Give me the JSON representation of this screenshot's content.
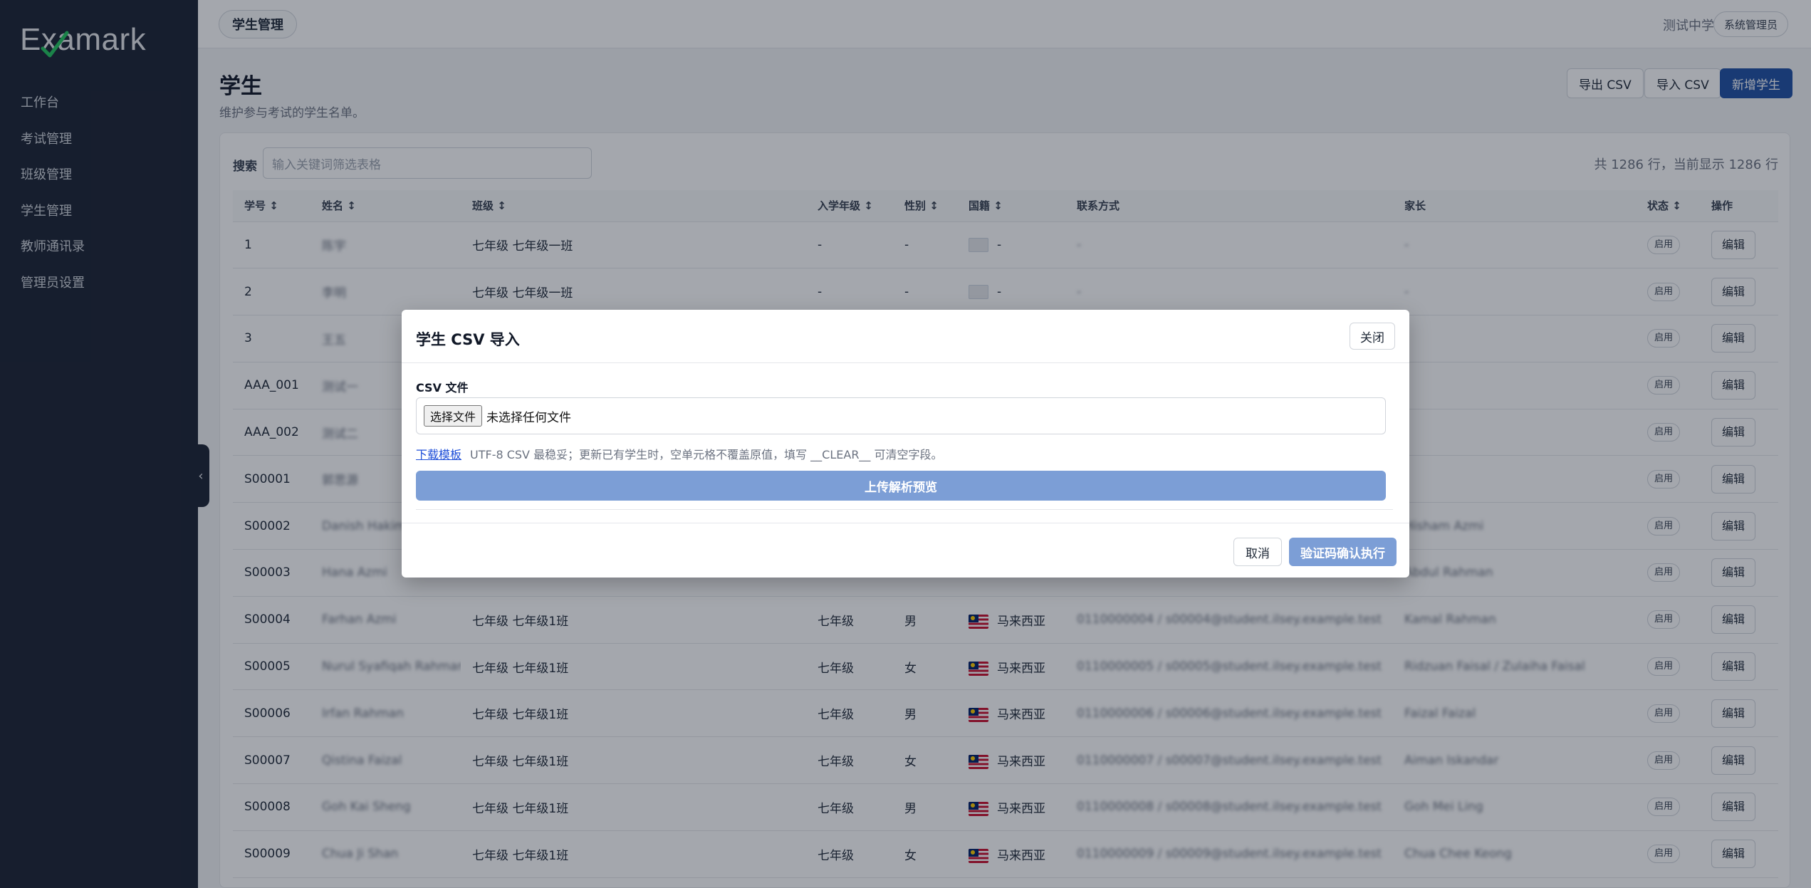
{
  "brand": {
    "logo_text": "Examark"
  },
  "sidebar": {
    "items": [
      {
        "label": "工作台"
      },
      {
        "label": "考试管理"
      },
      {
        "label": "班级管理"
      },
      {
        "label": "学生管理"
      },
      {
        "label": "教师通讯录"
      },
      {
        "label": "管理员设置"
      }
    ],
    "collapse_glyph": "‹"
  },
  "topbar": {
    "breadcrumb": "学生管理",
    "school": "测试中学",
    "role": "系统管理员"
  },
  "page": {
    "title": "学生",
    "subtitle": "维护参与考试的学生名单。",
    "export_label": "导出 CSV",
    "import_label": "导入 CSV",
    "add_label": "新增学生"
  },
  "search": {
    "label": "搜索",
    "placeholder": "输入关键词筛选表格",
    "count_text": "共 1286 行，当前显示 1286 行"
  },
  "table": {
    "columns": [
      "学号",
      "姓名",
      "班级",
      "入学年级",
      "性别",
      "国籍",
      "联系方式",
      "家长",
      "状态",
      "操作"
    ],
    "sort_glyph": "↕",
    "status_label": "启用",
    "edit_label": "编辑",
    "rows": [
      {
        "id": "1",
        "name": "陈宇",
        "class": "七年级 七年级一班",
        "grade": "-",
        "gender": "-",
        "flag": "blank",
        "nationality": "-",
        "contact": "-",
        "parent": "-"
      },
      {
        "id": "2",
        "name": "李明",
        "class": "七年级 七年级一班",
        "grade": "-",
        "gender": "-",
        "flag": "blank",
        "nationality": "-",
        "contact": "-",
        "parent": "-"
      },
      {
        "id": "3",
        "name": "王五",
        "class": "",
        "grade": "",
        "gender": "",
        "flag": "",
        "nationality": "",
        "contact": "",
        "parent": ""
      },
      {
        "id": "AAA_001",
        "name": "测试一",
        "class": "",
        "grade": "",
        "gender": "",
        "flag": "",
        "nationality": "",
        "contact": "",
        "parent": ""
      },
      {
        "id": "AAA_002",
        "name": "测试二",
        "class": "",
        "grade": "",
        "gender": "",
        "flag": "",
        "nationality": "",
        "contact": "",
        "parent": ""
      },
      {
        "id": "S00001",
        "name": "郭思源",
        "class": "",
        "grade": "",
        "gender": "",
        "flag": "",
        "nationality": "",
        "contact": "",
        "parent": ""
      },
      {
        "id": "S00002",
        "name": "Danish Hakim",
        "class": "",
        "grade": "",
        "gender": "",
        "flag": "",
        "nationality": "",
        "contact": "",
        "parent": "Hisham Azmi"
      },
      {
        "id": "S00003",
        "name": "Hana Azmi",
        "class": "",
        "grade": "",
        "gender": "",
        "flag": "",
        "nationality": "",
        "contact": "",
        "parent": "Abdul Rahman"
      },
      {
        "id": "S00004",
        "name": "Farhan Azmi",
        "class": "七年级 七年级1班",
        "grade": "七年级",
        "gender": "男",
        "flag": "my",
        "nationality": "马来西亚",
        "contact": "0110000004 / s00004@student.ilsey.example.test",
        "parent": "Kamal Rahman"
      },
      {
        "id": "S00005",
        "name": "Nurul Syafiqah Rahman",
        "class": "七年级 七年级1班",
        "grade": "七年级",
        "gender": "女",
        "flag": "my",
        "nationality": "马来西亚",
        "contact": "0110000005 / s00005@student.ilsey.example.test",
        "parent": "Ridzuan Faisal / Zulaiha Faisal"
      },
      {
        "id": "S00006",
        "name": "Irfan Rahman",
        "class": "七年级 七年级1班",
        "grade": "七年级",
        "gender": "男",
        "flag": "my",
        "nationality": "马来西亚",
        "contact": "0110000006 / s00006@student.ilsey.example.test",
        "parent": "Faizal Faizal"
      },
      {
        "id": "S00007",
        "name": "Qistina Faizal",
        "class": "七年级 七年级1班",
        "grade": "七年级",
        "gender": "女",
        "flag": "my",
        "nationality": "马来西亚",
        "contact": "0110000007 / s00007@student.ilsey.example.test",
        "parent": "Aiman Iskandar"
      },
      {
        "id": "S00008",
        "name": "Goh Kai Sheng",
        "class": "七年级 七年级1班",
        "grade": "七年级",
        "gender": "男",
        "flag": "my",
        "nationality": "马来西亚",
        "contact": "0110000008 / s00008@student.ilsey.example.test",
        "parent": "Goh Mei Ling"
      },
      {
        "id": "S00009",
        "name": "Chua Ji Shan",
        "class": "七年级 七年级1班",
        "grade": "七年级",
        "gender": "女",
        "flag": "my",
        "nationality": "马来西亚",
        "contact": "0110000009 / s00009@student.ilsey.example.test",
        "parent": "Chua Chee Keong"
      }
    ]
  },
  "modal": {
    "title": "学生 CSV 导入",
    "close_label": "关闭",
    "csv_label": "CSV 文件",
    "choose_file_label": "选择文件",
    "no_file_text": "未选择任何文件",
    "template_link": "下载模板",
    "template_hint": "UTF-8 CSV 最稳妥；更新已有学生时，空单元格不覆盖原值，填写 __CLEAR__ 可清空字段。",
    "upload_label": "上传解析预览",
    "cancel_label": "取消",
    "confirm_label": "验证码确认执行"
  },
  "colors": {
    "sidebar_bg": "#1a2233",
    "primary": "#1f4fa3",
    "primary_disabled": "#7c9ed6",
    "link": "#1d4ed8"
  }
}
